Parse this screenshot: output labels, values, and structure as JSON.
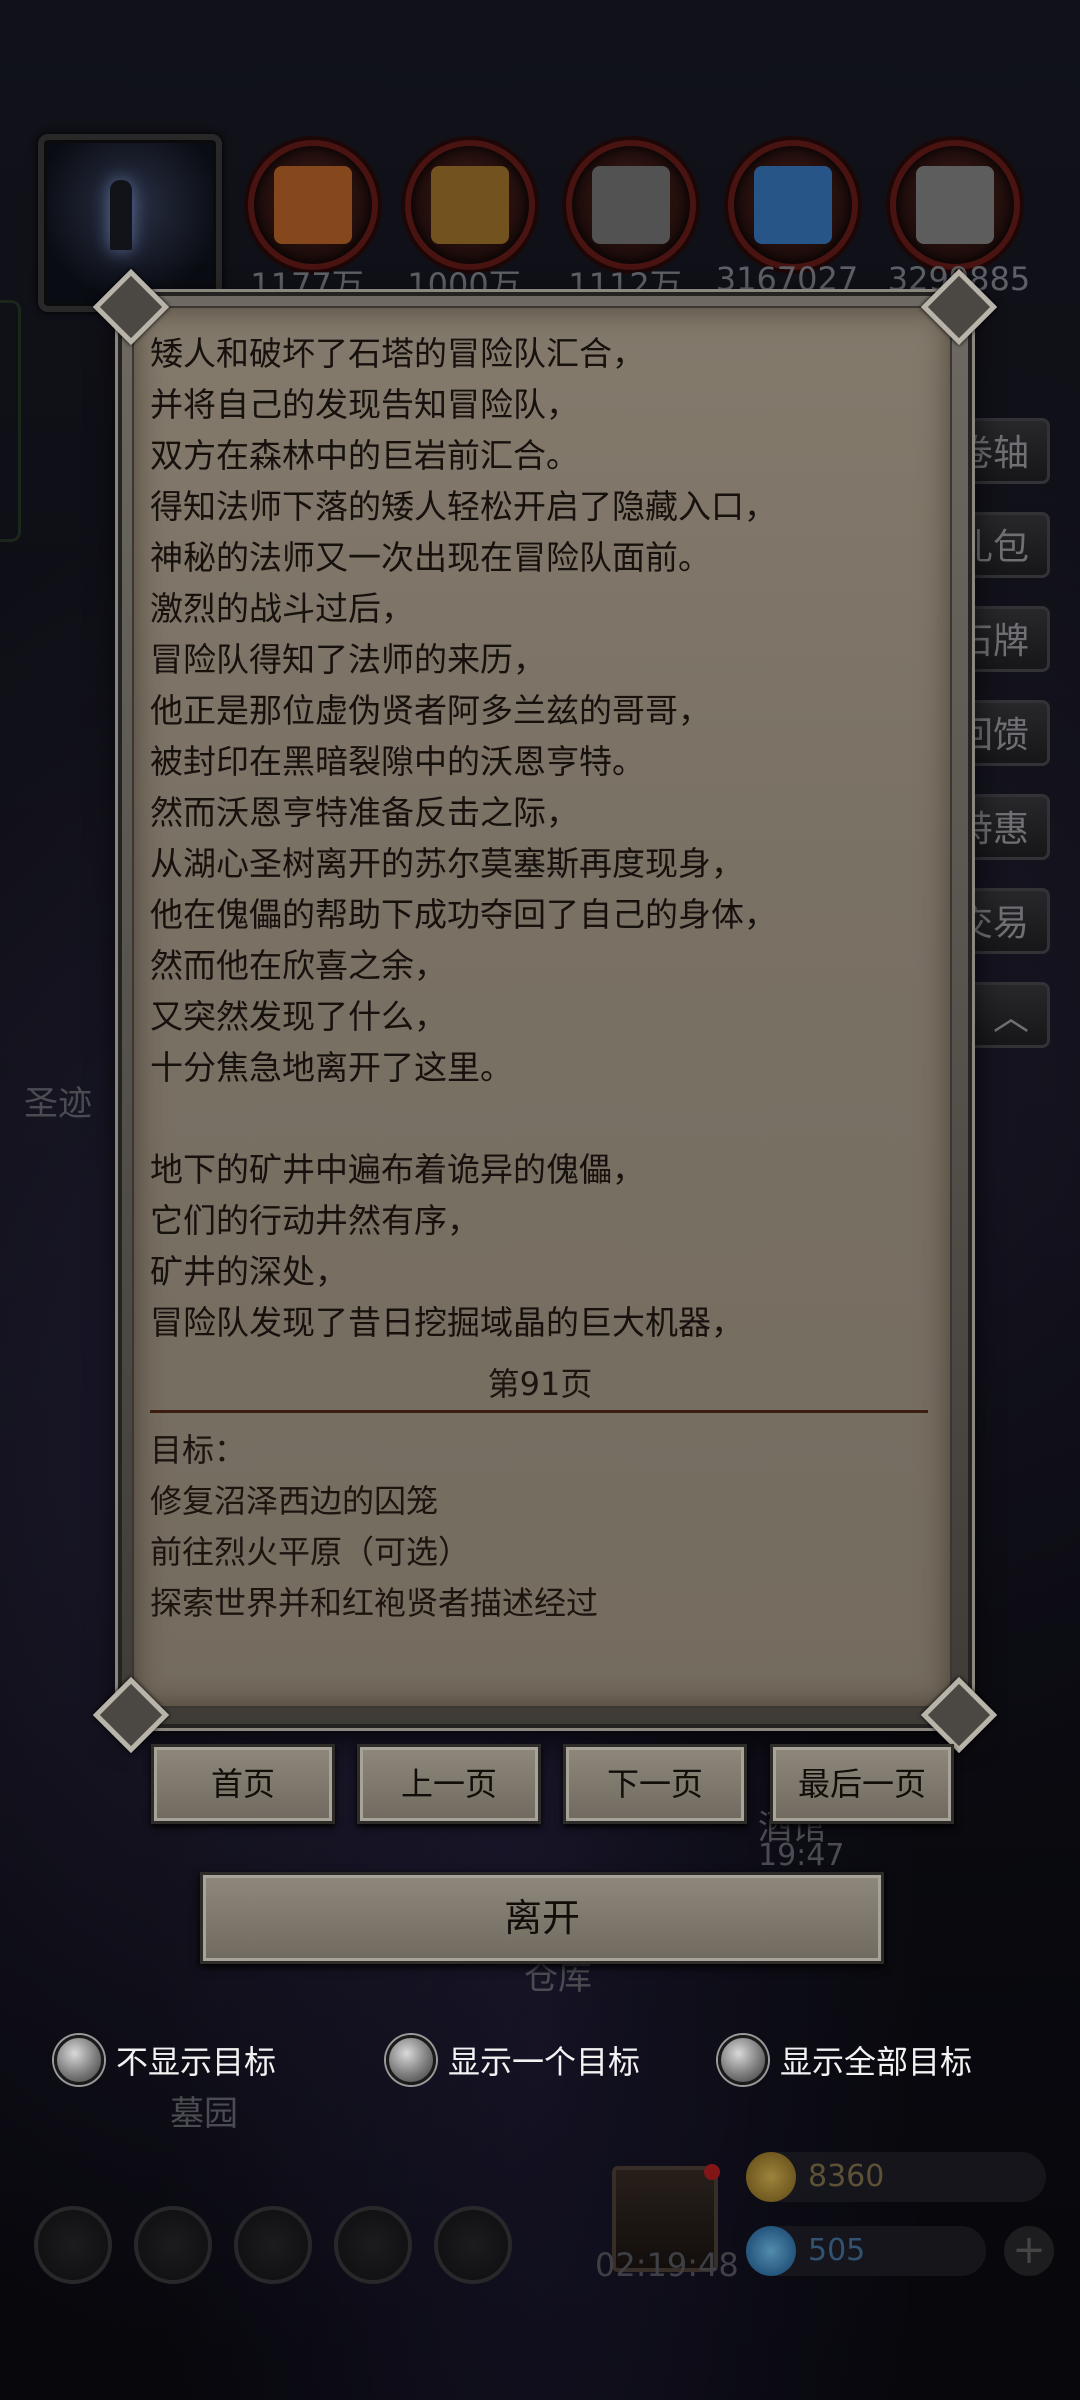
{
  "resources": [
    {
      "icon": "ore-icon",
      "value": "1177万",
      "color": "#c46a2a"
    },
    {
      "icon": "wood-icon",
      "value": "1000万",
      "color": "#a8792e"
    },
    {
      "icon": "stone-icon",
      "value": "1112万",
      "color": "#7a7a7a"
    },
    {
      "icon": "crystal-icon",
      "value": "3167027",
      "color": "#3a7ec8"
    },
    {
      "icon": "iron-icon",
      "value": "3299885",
      "color": "#8a8a8a"
    }
  ],
  "side_menu": [
    "卷轴",
    "礼包",
    "石牌",
    "的回馈",
    "特惠",
    "兰交易"
  ],
  "background_labels": {
    "left_place": "圣迹",
    "tavern": "酒馆",
    "tavern_time": "19:47",
    "warehouse": "仓库",
    "cemetery": "墓园"
  },
  "story_lines": [
    "矮人和破坏了石塔的冒险队汇合，",
    "并将自己的发现告知冒险队，",
    "双方在森林中的巨岩前汇合。",
    "得知法师下落的矮人轻松开启了隐藏入口，",
    "神秘的法师又一次出现在冒险队面前。",
    "激烈的战斗过后，",
    "冒险队得知了法师的来历，",
    "他正是那位虚伪贤者阿多兰兹的哥哥，",
    "被封印在黑暗裂隙中的沃恩亨特。",
    "然而沃恩亨特准备反击之际，",
    "从湖心圣树离开的苏尔莫塞斯再度现身，",
    "他在傀儡的帮助下成功夺回了自己的身体，",
    "然而他在欣喜之余，",
    "又突然发现了什么，",
    "十分焦急地离开了这里。",
    "",
    "地下的矿井中遍布着诡异的傀儡，",
    "它们的行动井然有序，",
    "矿井的深处，",
    "冒险队发现了昔日挖掘域晶的巨大机器，"
  ],
  "page_label": "第91页",
  "goals": {
    "heading": "目标：",
    "items": [
      "修复沼泽西边的囚笼",
      "前往烈火平原（可选）",
      "探索世界并和红袍贤者描述经过"
    ]
  },
  "nav_buttons": {
    "first": "首页",
    "prev": "上一页",
    "next": "下一页",
    "last": "最后一页"
  },
  "leave_button": "离开",
  "goal_display_options": [
    "不显示目标",
    "显示一个目标",
    "显示全部目标"
  ],
  "bottom_bar": {
    "gift_timer": "02:19:48",
    "gold": "8360",
    "gems": "505"
  }
}
